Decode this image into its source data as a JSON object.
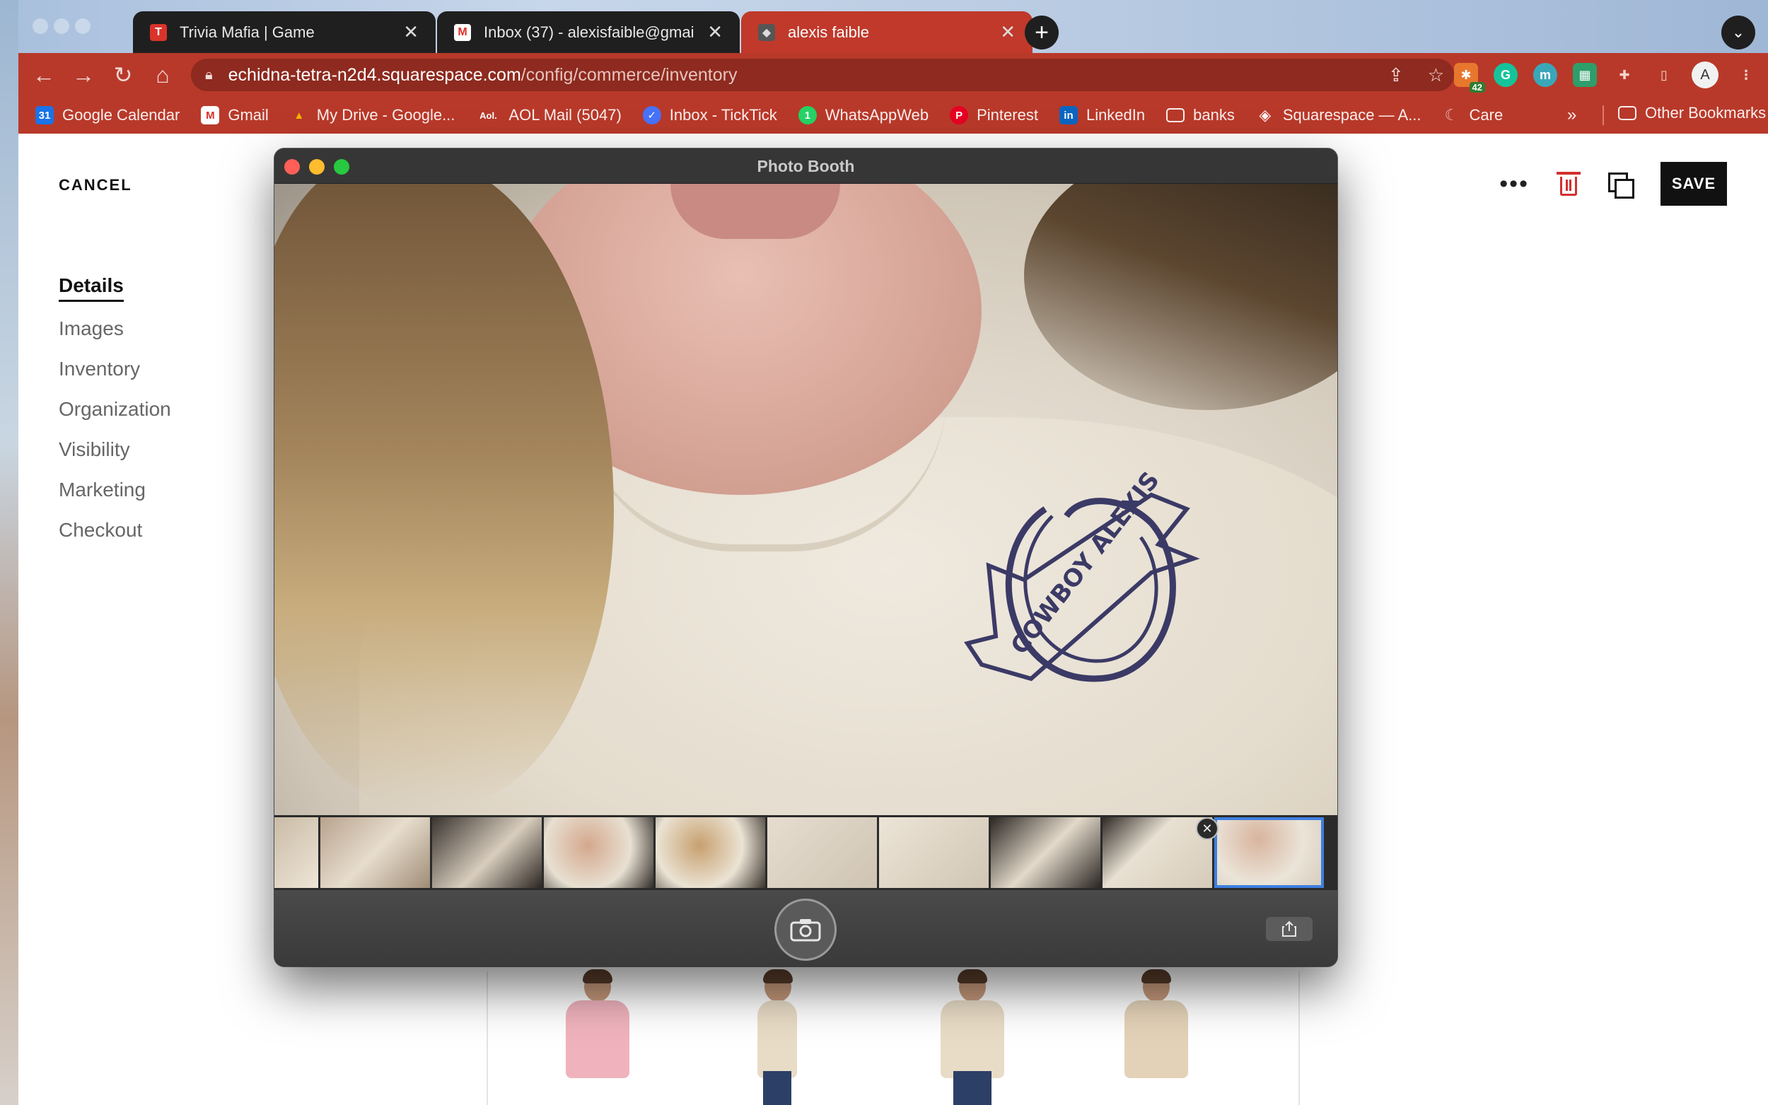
{
  "browser": {
    "tabs": [
      {
        "title": "Trivia Mafia | Game",
        "active": false
      },
      {
        "title": "Inbox (37) - alexisfaible@gmail",
        "active": false
      },
      {
        "title": "alexis faible",
        "active": true
      }
    ],
    "url_host": "echidna-tetra-n2d4.squarespace.com",
    "url_path": "/config/commerce/inventory",
    "extension_badge": "42",
    "bookmarks": [
      {
        "label": "Google Calendar",
        "icon": "calendar-icon",
        "color": "#1a73e8",
        "glyph": "31"
      },
      {
        "label": "Gmail",
        "icon": "gmail-icon",
        "color": "#d93025",
        "glyph": "M"
      },
      {
        "label": "My Drive - Google...",
        "icon": "drive-icon",
        "color": "#f4b400",
        "glyph": "▲"
      },
      {
        "label": "AOL Mail (5047)",
        "icon": "aol-icon",
        "color": "#111111",
        "glyph": "Aol."
      },
      {
        "label": "Inbox - TickTick",
        "icon": "ticktick-icon",
        "color": "#4772fa",
        "glyph": "✓"
      },
      {
        "label": "WhatsAppWeb",
        "icon": "whatsapp-icon",
        "color": "#25d366",
        "glyph": "1"
      },
      {
        "label": "Pinterest",
        "icon": "pinterest-icon",
        "color": "#e60023",
        "glyph": "P"
      },
      {
        "label": "LinkedIn",
        "icon": "linkedin-icon",
        "color": "#0a66c2",
        "glyph": "in"
      },
      {
        "label": "banks",
        "icon": "folder-icon",
        "color": "#b8392a",
        "glyph": "▭"
      },
      {
        "label": "Squarespace — A...",
        "icon": "squarespace-icon",
        "color": "#b8392a",
        "glyph": "◈"
      },
      {
        "label": "Care",
        "icon": "care-icon",
        "color": "#b8392a",
        "glyph": "☾"
      }
    ],
    "bookmarks_more": "»",
    "other_bookmarks": "Other Bookmarks"
  },
  "editor": {
    "cancel_label": "CANCEL",
    "save_label": "SAVE",
    "more_label": "•••",
    "nav": [
      {
        "label": "Details",
        "active": true
      },
      {
        "label": "Images",
        "active": false
      },
      {
        "label": "Inventory",
        "active": false
      },
      {
        "label": "Organization",
        "active": false
      },
      {
        "label": "Visibility",
        "active": false
      },
      {
        "label": "Marketing",
        "active": false
      },
      {
        "label": "Checkout",
        "active": false
      }
    ]
  },
  "photobooth": {
    "title": "Photo Booth",
    "shirt_print": "COWBOY ALEXIS",
    "thumbnail_count": 10,
    "selected_thumbnail": 10
  },
  "colors": {
    "browser_accent": "#b8392a",
    "save_button": "#111111",
    "delete_icon": "#d32f2f",
    "selection_outline": "#3f7fe0"
  }
}
